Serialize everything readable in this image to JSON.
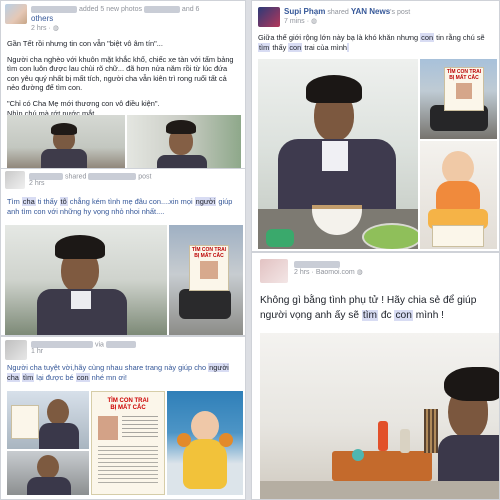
{
  "post1": {
    "action": "added 5 new photos",
    "connector": "and 6",
    "others": "others",
    "time": "2 hrs",
    "lines": [
      "Gần Tết rồi nhưng tin con vẫn \"biệt vô âm tín\"...",
      "Người cha nghèo với khuôn mặt khắc khổ, chiếc xe tàn với tấm bảng tìm con luôn được lau chùi rõ chữ... đã hơn nửa năm rồi từ lúc đứa con yêu quý nhất bị mất tích, người cha vẫn kiên trì rong ruổi tất cả nẻo đường để tìm con.",
      "\"Chỉ có Cha Mẹ mới thương con vô điều kiện\".",
      "Nhìn chú mà rớt nước mắt."
    ]
  },
  "post2": {
    "action": "shared",
    "suffix": "post",
    "time": "2 hrs",
    "text_parts": [
      "Tìm ",
      "cha",
      " ti thấy ",
      "tô",
      " chẳng kém tình mẹ đâu con....xin mọi ",
      "người",
      " giúp anh tìm con với những hy vọng nhỏ nhoi nhất...."
    ]
  },
  "post3": {
    "via": "via",
    "time": "1 hr",
    "text_parts": [
      "Người cha tuyệt vời,hãy cùng nhau share trang này giúp cho ",
      "người cha",
      " ",
      "tìm",
      " lại được bé ",
      "con",
      " nhé mn ơi!"
    ]
  },
  "post4": {
    "author": "Supi Phạm",
    "shared": "shared",
    "page": "YAN News",
    "suffix": "'s post",
    "time": "7 mins",
    "text_parts": [
      "Giữa thế giới rộng lớn này bạ là khó khăn nhưng ",
      "con",
      " tin rằng chú sẽ ",
      "tìm",
      " thấy ",
      "con",
      " trai của mình ",
      "  "
    ]
  },
  "post5": {
    "time": "2 hrs",
    "source": "Baomoi.com",
    "text_parts": [
      "Không gì bằng tình phụ tử ! Hãy chia sẻ để giúp người vọng anh ấy sẽ ",
      "tìm",
      " đc ",
      "con",
      " mình !"
    ]
  },
  "sign": {
    "line1": "TÌM CON TRAI",
    "line2": "BỊ MẤT CẮC"
  },
  "colors": {
    "link": "#365899",
    "highlight": "#d8dcf3",
    "page_bg": "#dcdee3",
    "card_bg": "#ffffff"
  }
}
